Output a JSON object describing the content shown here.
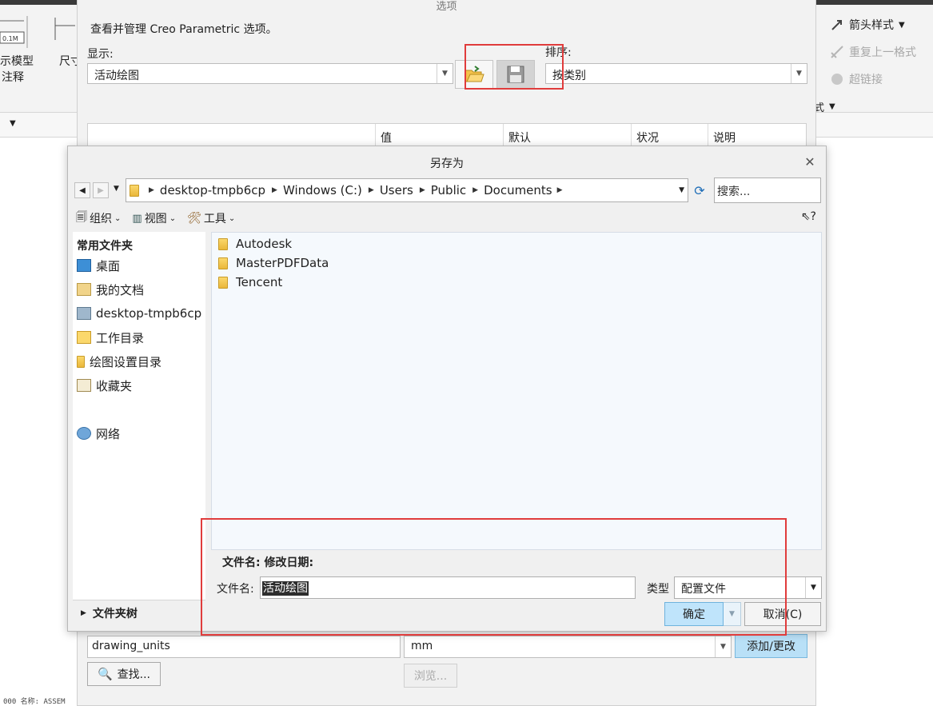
{
  "ribbon": {
    "left_label_1": "示模型",
    "left_label_2": "注释",
    "dim_label": "尺寸",
    "right_items": [
      {
        "label": "箭头样式",
        "has_dropdown": true
      },
      {
        "label": "重复上一格式",
        "disabled": true
      },
      {
        "label": "超链接",
        "disabled": true
      }
    ],
    "format_group": "式"
  },
  "status_bar": {
    "text": "000  名称: ASSEM"
  },
  "options_dialog": {
    "title": "选项",
    "description": "查看并管理 Creo Parametric 选项。",
    "show_label": "显示:",
    "show_value": "活动绘图",
    "sort_label": "排序:",
    "sort_value": "按类别",
    "table_columns": [
      "值",
      "默认",
      "状况",
      "说明"
    ],
    "option_name_value": "drawing_units",
    "option_value_value": "mm",
    "add_change_button": "添加/更改",
    "find_button": "查找...",
    "browse_button": "浏览..."
  },
  "saveas_dialog": {
    "title": "另存为",
    "breadcrumbs": [
      "desktop-tmpb6cp",
      "Windows (C:)",
      "Users",
      "Public",
      "Documents"
    ],
    "search_placeholder": "搜索...",
    "toolbar": {
      "organize": "组织",
      "view": "视图",
      "tools": "工具"
    },
    "left_pane": {
      "header": "常用文件夹",
      "items": [
        {
          "label": "桌面",
          "icon": "desktop-icon"
        },
        {
          "label": "我的文档",
          "icon": "documents-icon"
        },
        {
          "label": "desktop-tmpb6cp",
          "icon": "computer-icon"
        },
        {
          "label": "工作目录",
          "icon": "working-dir-icon"
        },
        {
          "label": "绘图设置目录",
          "icon": "folder-icon"
        },
        {
          "label": "收藏夹",
          "icon": "favorites-icon"
        },
        {
          "label": "网络",
          "icon": "network-icon"
        }
      ]
    },
    "files": [
      "Autodesk",
      "MasterPDFData",
      "Tencent"
    ],
    "meta_row": "文件名:  修改日期:",
    "filename_label": "文件名:",
    "filename_value": "活动绘图",
    "type_label": "类型",
    "type_value": "配置文件",
    "folder_tree_label": "文件夹树",
    "ok_button": "确定",
    "cancel_button": "取消(C)"
  },
  "colors": {
    "annotation_red": "#e03c3c",
    "primary_button": "#bfe4fb",
    "selection": "#2d2d2d"
  }
}
